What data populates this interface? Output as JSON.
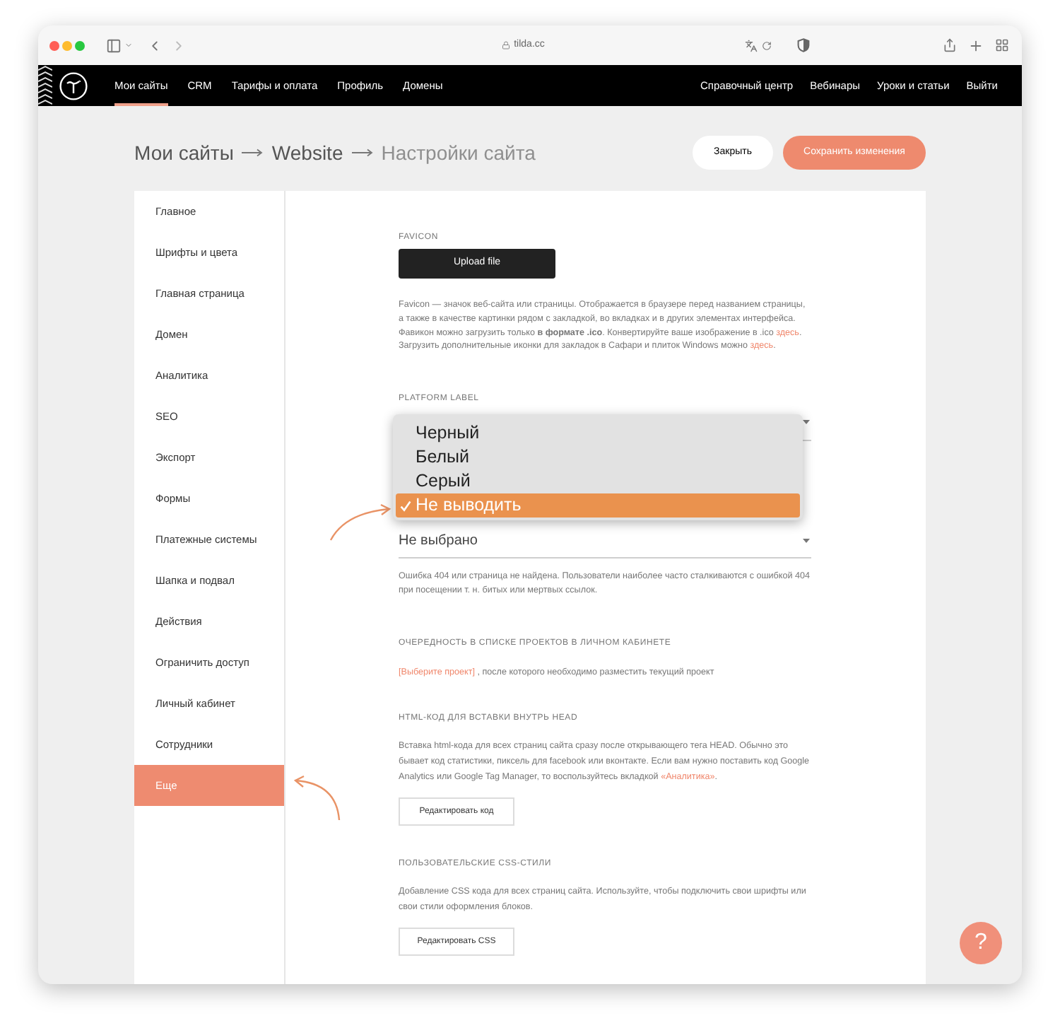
{
  "browser": {
    "url": "tilda.cc"
  },
  "nav": {
    "left": [
      {
        "label": "Мои сайты",
        "selected": true
      },
      {
        "label": "CRM",
        "selected": false
      },
      {
        "label": "Тарифы и оплата",
        "selected": false
      },
      {
        "label": "Профиль",
        "selected": false
      },
      {
        "label": "Домены",
        "selected": false
      }
    ],
    "right": [
      {
        "label": "Справочный центр"
      },
      {
        "label": "Вебинары"
      },
      {
        "label": "Уроки и статьи"
      },
      {
        "label": "Выйти"
      }
    ]
  },
  "header": {
    "breadcrumb": [
      {
        "label": "Мои сайты",
        "current": false
      },
      {
        "label": "Website",
        "current": false
      },
      {
        "label": "Настройки сайта",
        "current": true
      }
    ],
    "buttons": [
      {
        "label": "Закрыть",
        "kind": "secondary"
      },
      {
        "label": "Сохранить изменения",
        "kind": "primary"
      }
    ]
  },
  "sidebar": {
    "items": [
      {
        "label": "Главное",
        "selected": false
      },
      {
        "label": "Шрифты и цвета",
        "selected": false
      },
      {
        "label": "Главная страница",
        "selected": false
      },
      {
        "label": "Домен",
        "selected": false
      },
      {
        "label": "Аналитика",
        "selected": false
      },
      {
        "label": "SEO",
        "selected": false
      },
      {
        "label": "Экспорт",
        "selected": false
      },
      {
        "label": "Формы",
        "selected": false
      },
      {
        "label": "Платежные системы",
        "selected": false
      },
      {
        "label": "Шапка и подвал",
        "selected": false
      },
      {
        "label": "Действия",
        "selected": false
      },
      {
        "label": "Ограничить доступ",
        "selected": false
      },
      {
        "label": "Личный кабинет",
        "selected": false
      },
      {
        "label": "Сотрудники",
        "selected": false
      },
      {
        "label": "Еще",
        "selected": true
      }
    ]
  },
  "sections": [
    {
      "kind": "upload",
      "title": "FAVICON",
      "button": "Upload file",
      "text": [
        {
          "kind": "plain",
          "text": "Favicon — значок веб-сайта или страницы. Отображается в браузере перед названием страницы, а также в качестве картинки рядом с закладкой, во вкладках и в других элементах интерфейса. Фавикон можно загрузить только **в формате .ico**. Конвертируйте ваше изображение в .ico "
        },
        {
          "kind": "link",
          "text": "здесь"
        },
        {
          "kind": "plain",
          "text": ". Загрузить дополнительные иконки для закладок в Сафари и плиток Windows можно "
        },
        {
          "kind": "link",
          "text": "здесь"
        },
        {
          "kind": "plain",
          "text": "."
        }
      ]
    },
    {
      "kind": "dropdown",
      "title": "PLATFORM LABEL",
      "options": [
        {
          "label": "Черный",
          "selected": false
        },
        {
          "label": "Белый",
          "selected": false
        },
        {
          "label": "Серый",
          "selected": false
        },
        {
          "label": "Не выводить",
          "selected": true
        }
      ]
    },
    {
      "kind": "select",
      "value": "Не выбрано",
      "text": [
        {
          "kind": "plain",
          "text": "Ошибка 404 или страница не найдена. Пользователи наиболее часто сталкиваются с ошибкой 404 при посещении т. н. битых или мертвых ссылок."
        }
      ]
    },
    {
      "kind": "text",
      "title": "ОЧЕРЕДНОСТЬ В СПИСКЕ ПРОЕКТОВ В ЛИЧНОМ КАБИНЕТЕ",
      "text": [
        {
          "kind": "link",
          "text": "[Выберите проект]"
        },
        {
          "kind": "plain",
          "text": " , после которого необходимо разместить текущий проект"
        }
      ]
    },
    {
      "kind": "code",
      "title": "HTML-КОД ДЛЯ ВСТАВКИ ВНУТРЬ HEAD",
      "text": [
        {
          "kind": "plain",
          "text": "Вставка html-кода для всех страниц сайта сразу после открывающего тега HEAD. Обычно это бывает код статистики, пиксель для facebook или вконтакте. Если вам нужно поставить код Google Analytics или Google Tag Manager, то воспользуйтесь вкладкой "
        },
        {
          "kind": "link",
          "text": "«Аналитика»"
        },
        {
          "kind": "plain",
          "text": "."
        }
      ],
      "button": "Редактировать код"
    },
    {
      "kind": "code",
      "title": "ПОЛЬЗОВАТЕЛЬСКИЕ CSS-СТИЛИ",
      "text": [
        {
          "kind": "plain",
          "text": "Добавление CSS кода для всех страниц сайта. Используйте, чтобы подключить свои шрифты или свои стили оформления блоков."
        }
      ],
      "button": "Редактировать CSS"
    }
  ],
  "help": {
    "label": "?"
  }
}
